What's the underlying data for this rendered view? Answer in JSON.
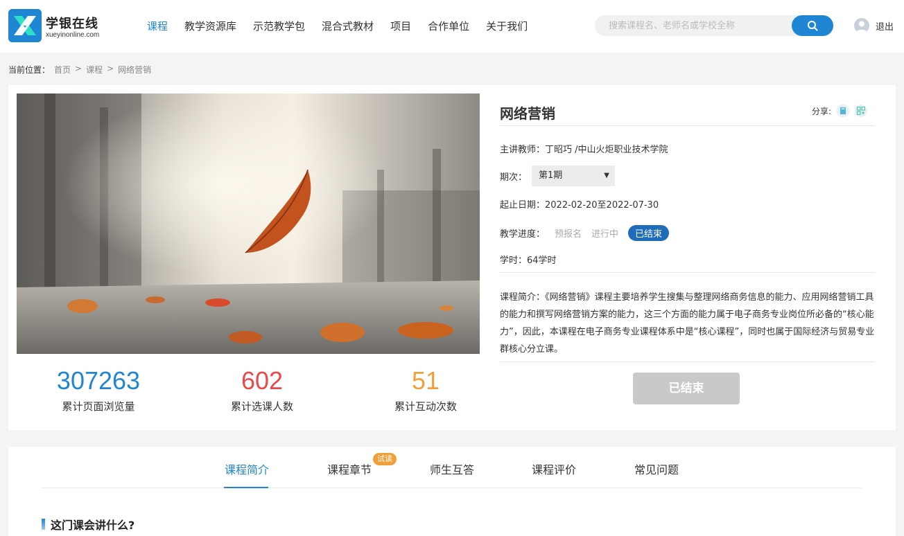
{
  "brand": {
    "name": "学银在线",
    "domain": "xueyinonline.com"
  },
  "nav": [
    {
      "label": "课程",
      "active": true
    },
    {
      "label": "教学资源库"
    },
    {
      "label": "示范教学包"
    },
    {
      "label": "混合式教材"
    },
    {
      "label": "项目"
    },
    {
      "label": "合作单位"
    },
    {
      "label": "关于我们"
    }
  ],
  "search": {
    "placeholder": "搜索课程名、老师名或学校全称"
  },
  "user": {
    "logout_label": "退出"
  },
  "breadcrumb": {
    "prefix": "当前位置：",
    "items": [
      "首页",
      "课程",
      "网络营销"
    ],
    "separator": ">"
  },
  "course": {
    "title": "网络营销",
    "share_label": "分享:",
    "teacher": "主讲教师：丁昭巧 /中山火炬职业技术学院",
    "term_label": "期次：",
    "term_value": "第1期",
    "dates": "起止日期：2022-02-20至2022-07-30",
    "progress_label": "教学进度：",
    "progress_steps": [
      "预报名",
      "进行中",
      "已结束"
    ],
    "progress_current": "已结束",
    "hours": "学时：64学时",
    "intro": "课程简介：《网络营销》课程主要培养学生搜集与整理网络商务信息的能力、应用网络营销工具的能力和撰写网络营销方案的能力，这三个方面的能力属于电子商务专业岗位所必备的“核心能力”，因此，本课程在电子商务专业课程体系中是“核心课程”，同时也属于国际经济与贸易专业群核心分立课。",
    "status_button": "已结束"
  },
  "stats": [
    {
      "value": "307263",
      "label": "累计页面浏览量",
      "color": "#1f86d3"
    },
    {
      "value": "602",
      "label": "累计选课人数",
      "color": "#e84a4a"
    },
    {
      "value": "51",
      "label": "累计互动次数",
      "color": "#f0a03a"
    }
  ],
  "tabs": [
    {
      "label": "课程简介",
      "active": true
    },
    {
      "label": "课程章节",
      "badge": "试读"
    },
    {
      "label": "师生互答"
    },
    {
      "label": "课程评价"
    },
    {
      "label": "常见问题"
    }
  ],
  "section": {
    "title": "这门课会讲什么?"
  },
  "colors": {
    "accent": "#1f86d3",
    "ended_button": "#c9c9c9",
    "progress_active": "#1f6db8"
  }
}
